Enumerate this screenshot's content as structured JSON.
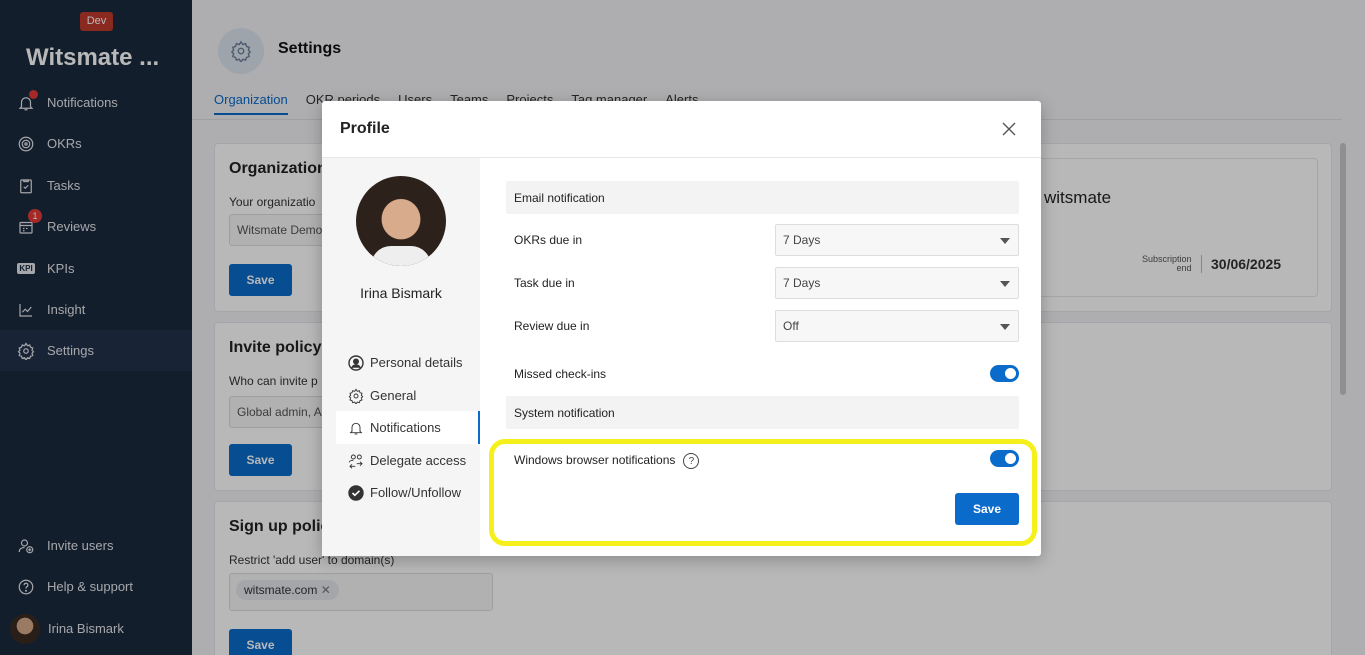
{
  "sidebar": {
    "env_badge": "Dev",
    "brand": "Witsmate ...",
    "items": [
      {
        "label": "Notifications",
        "icon": "bell-icon"
      },
      {
        "label": "OKRs",
        "icon": "target-icon"
      },
      {
        "label": "Tasks",
        "icon": "clipboard-check-icon"
      },
      {
        "label": "Reviews",
        "icon": "calendar-icon",
        "badge": "1"
      },
      {
        "label": "KPIs",
        "icon": "kpi-icon",
        "icon_text": "KPI"
      },
      {
        "label": "Insight",
        "icon": "trend-chart-icon"
      },
      {
        "label": "Settings",
        "icon": "gear-icon"
      }
    ],
    "bottom": [
      {
        "label": "Invite users",
        "icon": "add-user-icon"
      },
      {
        "label": "Help & support",
        "icon": "help-icon"
      },
      {
        "label": "Irina Bismark",
        "icon": "avatar"
      }
    ]
  },
  "page": {
    "title": "Settings",
    "tabs": [
      "Organization",
      "OKR periods",
      "Users",
      "Teams",
      "Projects",
      "Tag manager",
      "Alerts"
    ],
    "active_tab": "Organization"
  },
  "background_cards": {
    "org_title": "Organization",
    "org_label": "Your organizatio",
    "org_value": "Witsmate Demo",
    "save": "Save",
    "brand_name": "witsmate",
    "subscription_label_1": "Subscription",
    "subscription_label_2": "end",
    "subscription_end": "30/06/2025",
    "invite_title": "Invite policy",
    "invite_label": "Who can invite p",
    "invite_value": "Global admin, A",
    "signup_title": "Sign up polic",
    "signup_label": "Restrict 'add user' to domain(s)",
    "domain_chip": "witsmate.com",
    "chip_remove": "✕"
  },
  "modal": {
    "title": "Profile",
    "close": "✕",
    "user_name": "Irina Bismark",
    "menu": [
      {
        "label": "Personal details",
        "icon": "person-circle-icon"
      },
      {
        "label": "General",
        "icon": "gear-icon"
      },
      {
        "label": "Notifications",
        "icon": "bell-icon"
      },
      {
        "label": "Delegate access",
        "icon": "delegate-icon"
      },
      {
        "label": "Follow/Unfollow",
        "icon": "check-circle-icon"
      }
    ],
    "active_menu": "Notifications",
    "email_section": "Email notification",
    "okrs_due_label": "OKRs due in",
    "okrs_due_value": "7 Days",
    "task_due_label": "Task due in",
    "task_due_value": "7 Days",
    "review_due_label": "Review due in",
    "review_due_value": "Off",
    "missed_checkins_label": "Missed check-ins",
    "missed_checkins_on": true,
    "system_section": "System notification",
    "browser_notif_label": "Windows browser notifications",
    "help_glyph": "?",
    "browser_notif_on": true,
    "save": "Save"
  },
  "colors": {
    "sidebar_bg": "#1b2a3f",
    "accent": "#0b6bcb",
    "highlight": "#f5f01b",
    "badge": "#e53935"
  }
}
